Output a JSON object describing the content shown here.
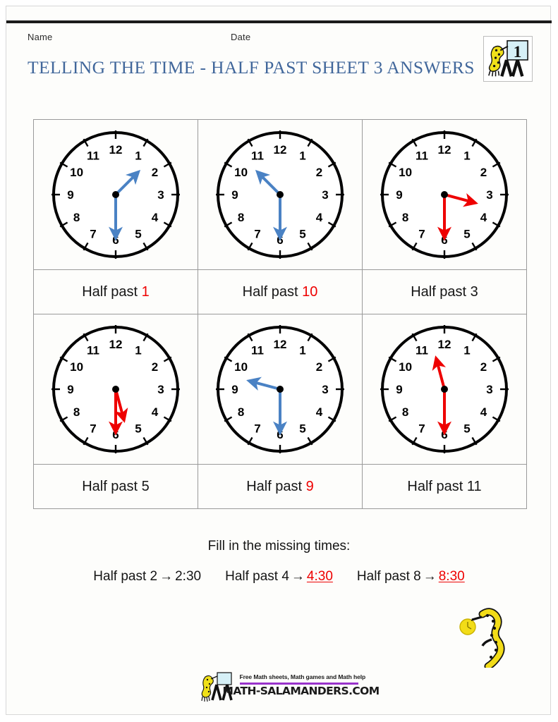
{
  "header": {
    "name_label": "Name",
    "date_label": "Date",
    "title": "TELLING THE TIME - HALF PAST SHEET 3 ANSWERS",
    "badge_number": "1",
    "title_color": "#41679b"
  },
  "colors": {
    "answer_red": "#ee0000",
    "given_blue": "#4a82c4",
    "text_black": "#161616",
    "grid_line": "#9a9a9a"
  },
  "clock_face": {
    "numerals": [
      "12",
      "1",
      "2",
      "3",
      "4",
      "5",
      "6",
      "7",
      "8",
      "9",
      "10",
      "11"
    ]
  },
  "clocks": [
    {
      "id": "clock-1",
      "hand_color": "#4a82c4",
      "is_answer": false,
      "hour_value": 1,
      "minute_value": 30,
      "hour_angle": 45,
      "minute_angle": 180,
      "label_prefix": "Half past ",
      "label_answer": "1",
      "answer_is_red": true
    },
    {
      "id": "clock-2",
      "hand_color": "#4a82c4",
      "is_answer": false,
      "hour_value": 10,
      "minute_value": 30,
      "hour_angle": 315,
      "minute_angle": 180,
      "label_prefix": "Half past ",
      "label_answer": "10",
      "answer_is_red": true
    },
    {
      "id": "clock-3",
      "hand_color": "#ee0000",
      "is_answer": true,
      "hour_value": 3,
      "minute_value": 30,
      "hour_angle": 105,
      "minute_angle": 180,
      "label_prefix": "Half past ",
      "label_answer": "3",
      "answer_is_red": false
    },
    {
      "id": "clock-4",
      "hand_color": "#ee0000",
      "is_answer": true,
      "hour_value": 5,
      "minute_value": 30,
      "hour_angle": 165,
      "minute_angle": 180,
      "label_prefix": "Half past ",
      "label_answer": "5",
      "answer_is_red": false
    },
    {
      "id": "clock-5",
      "hand_color": "#4a82c4",
      "is_answer": false,
      "hour_value": 9,
      "minute_value": 30,
      "hour_angle": 285,
      "minute_angle": 180,
      "label_prefix": "Half past ",
      "label_answer": "9",
      "answer_is_red": true
    },
    {
      "id": "clock-6",
      "hand_color": "#ee0000",
      "is_answer": true,
      "hour_value": 11,
      "minute_value": 30,
      "hour_angle": 345,
      "minute_angle": 180,
      "label_prefix": "Half past ",
      "label_answer": "11",
      "answer_is_red": false
    }
  ],
  "fill_in": {
    "title": "Fill in the missing times:",
    "arrow": "→",
    "items": [
      {
        "prompt": "Half past 2",
        "answer": "2:30",
        "is_answer_red": false
      },
      {
        "prompt": "Half past 4",
        "answer": "4:30",
        "is_answer_red": true
      },
      {
        "prompt": "Half past 8",
        "answer": "8:30",
        "is_answer_red": true
      }
    ]
  },
  "footer": {
    "tagline": "Free Math sheets, Math games and Math help",
    "domain": "MATH-SALAMANDERS.COM",
    "underline_color": "#9933cc"
  }
}
